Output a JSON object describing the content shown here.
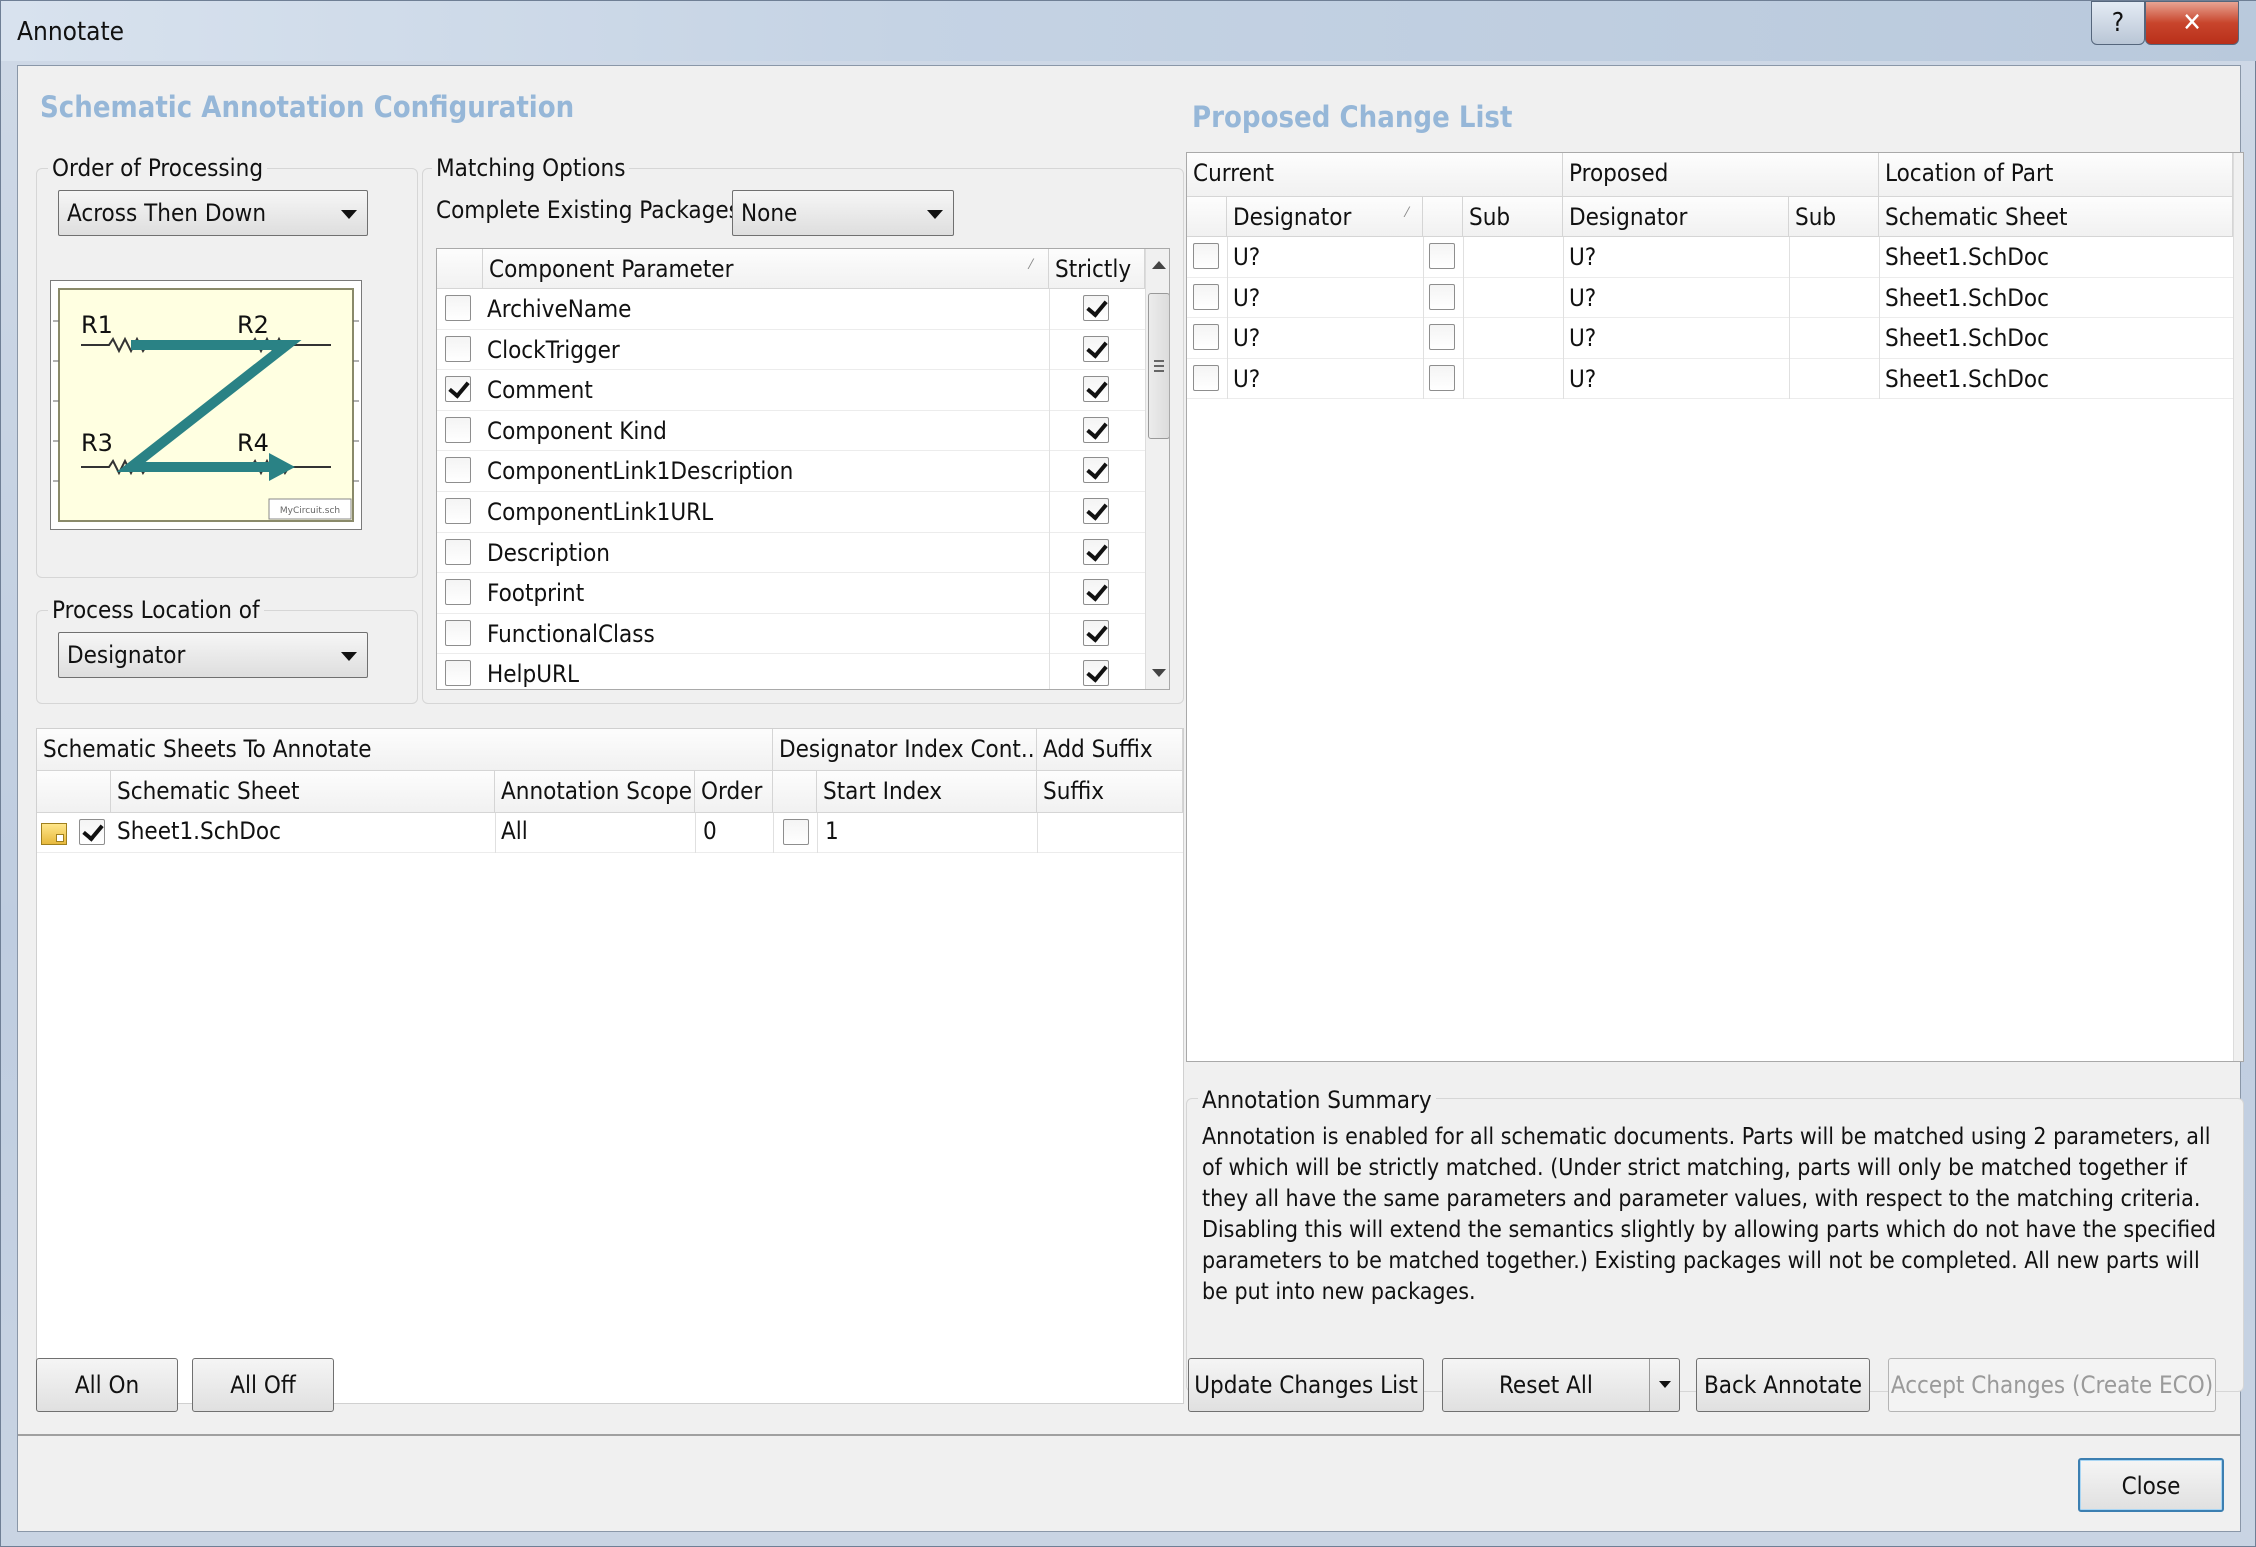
{
  "window": {
    "title": "Annotate",
    "help_glyph": "?",
    "close_glyph": "✕"
  },
  "config": {
    "section_title": "Schematic Annotation Configuration",
    "order_of_processing": {
      "label": "Order of Processing",
      "value": "Across Then Down"
    },
    "diagram": {
      "labels": [
        "R1",
        "R2",
        "R3",
        "R4"
      ],
      "caption": "MyCircuit.sch"
    },
    "process_location": {
      "label": "Process Location of",
      "value": "Designator"
    }
  },
  "matching": {
    "label": "Matching Options",
    "complete_label": "Complete Existing Packages",
    "complete_value": "None",
    "headers": {
      "param": "Component Parameter",
      "strictly": "Strictly"
    },
    "rows": [
      {
        "name": "ArchiveName",
        "checked": false,
        "strict": true
      },
      {
        "name": "ClockTrigger",
        "checked": false,
        "strict": true
      },
      {
        "name": "Comment",
        "checked": true,
        "strict": true
      },
      {
        "name": "Component Kind",
        "checked": false,
        "strict": true
      },
      {
        "name": "ComponentLink1Description",
        "checked": false,
        "strict": true
      },
      {
        "name": "ComponentLink1URL",
        "checked": false,
        "strict": true
      },
      {
        "name": "Description",
        "checked": false,
        "strict": true
      },
      {
        "name": "Footprint",
        "checked": false,
        "strict": true
      },
      {
        "name": "FunctionalClass",
        "checked": false,
        "strict": true
      },
      {
        "name": "HelpURL",
        "checked": false,
        "strict": true
      }
    ]
  },
  "sheets": {
    "headers": {
      "group1": "Schematic Sheets To Annotate",
      "group2": "Designator Index Cont...",
      "group3": "Add Suffix",
      "sheet": "Schematic Sheet",
      "scope": "Annotation Scope",
      "order": "Order",
      "start": "Start Index",
      "suffix": "Suffix"
    },
    "rows": [
      {
        "sheet": "Sheet1.SchDoc",
        "scope": "All",
        "order": "0",
        "start": "1",
        "suffix": "",
        "checked": true,
        "index_checked": false
      }
    ]
  },
  "buttons": {
    "all_on": "All On",
    "all_off": "All Off",
    "update": "Update Changes List",
    "reset": "Reset All",
    "back": "Back Annotate",
    "accept": "Accept Changes (Create ECO)",
    "close": "Close"
  },
  "changes": {
    "title": "Proposed Change List",
    "headers": {
      "current": "Current",
      "proposed": "Proposed",
      "location": "Location of Part",
      "designator": "Designator",
      "sub": "Sub",
      "sheet": "Schematic Sheet"
    },
    "rows": [
      {
        "current": "U?",
        "proposed": "U?",
        "sheet": "Sheet1.SchDoc"
      },
      {
        "current": "U?",
        "proposed": "U?",
        "sheet": "Sheet1.SchDoc"
      },
      {
        "current": "U?",
        "proposed": "U?",
        "sheet": "Sheet1.SchDoc"
      },
      {
        "current": "U?",
        "proposed": "U?",
        "sheet": "Sheet1.SchDoc"
      }
    ]
  },
  "summary": {
    "label": "Annotation Summary",
    "text": "Annotation is enabled for all schematic documents. Parts will be matched using 2 parameters, all of which will be strictly matched. (Under strict matching, parts will only be matched together if they all have the same parameters and parameter values, with respect to the matching criteria. Disabling this will extend the semantics slightly by allowing parts which do not have the specified parameters to be matched together.) Existing packages will not be completed. All new parts will be put into new packages."
  },
  "colors": {
    "section_title": "#96b7d8",
    "diagram_arrow": "#2a8285",
    "diagram_bg": "#ffffe1"
  }
}
